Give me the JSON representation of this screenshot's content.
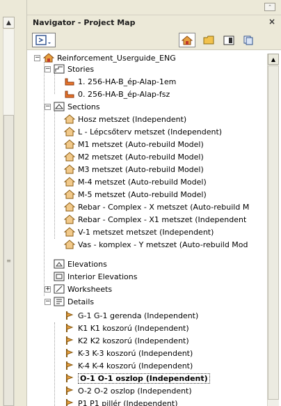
{
  "panel": {
    "title": "Navigator - Project Map",
    "close_glyph": "×"
  },
  "toolbar": {
    "mode_icon": "navigator-mode-icon",
    "buttons": [
      "project-map-icon",
      "view-map-icon",
      "layout-book-icon",
      "publisher-sets-icon"
    ]
  },
  "tree": {
    "root": "Reinforcement_Userguide_ENG",
    "stories_label": "Stories",
    "stories": [
      "1. 256-HA-B_ép-Alap-1em",
      "0. 256-HA-B_ép-Alap-fsz"
    ],
    "sections_label": "Sections",
    "sections": [
      "Hosz metszet (Independent)",
      "L - Lépcsőterv metszet (Independent)",
      "M1 metszet (Auto-rebuild Model)",
      "M2 metszet (Auto-rebuild Model)",
      "M3 metszet (Auto-rebuild Model)",
      "M-4 metszet (Auto-rebuild Model)",
      "M-5 metszet (Auto-rebuild Model)",
      "Rebar - Complex - X metszet (Auto-rebuild M",
      "Rebar - Complex - X1 metszet (Independent",
      "V-1 metszet metszet (Independent)",
      "Vas - komplex - Y metszet (Auto-rebuild Mod"
    ],
    "elevations_label": "Elevations",
    "interior_label": "Interior Elevations",
    "worksheets_label": "Worksheets",
    "details_label": "Details",
    "details": [
      "G-1 G-1 gerenda (Independent)",
      "K1 K1 koszorú (Independent)",
      "K2 K2 koszorú (Independent)",
      "K-3 K-3 koszorú (Independent)",
      "K-4 K-4 koszorú (Independent)",
      "O-1 O-1 oszlop (Independent)",
      "O-2 O-2 oszlop (Independent)",
      "P1 P1 pillér (Independent)"
    ],
    "selected_detail_index": 5
  }
}
